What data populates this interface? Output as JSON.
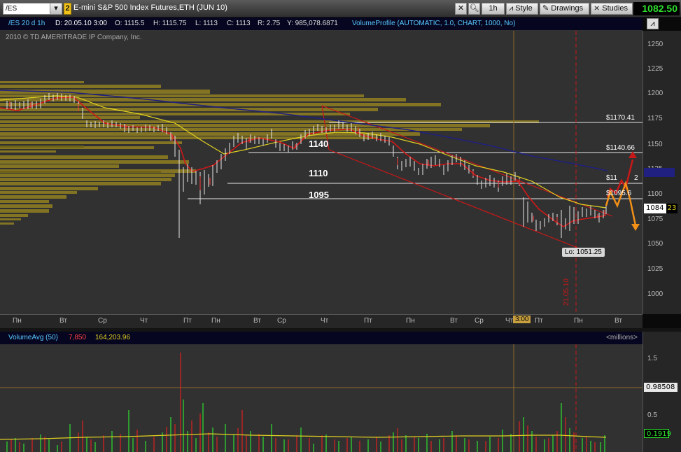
{
  "toolbar": {
    "symbol": "/ES",
    "link_number": "2",
    "instrument_title": "E-mini S&P 500 Index Futures,ETH (JUN 10)",
    "timeframe_label": "1h",
    "style_label": "Style",
    "drawings_label": "Drawings",
    "studies_label": "Studies",
    "last_price": "1082.50"
  },
  "header": {
    "chart_id": "/ES 20 d 1h",
    "date": "D: 20.05.10 3:00",
    "open": "O: 1115.5",
    "high": "H: 1115.75",
    "low": "L: 1113",
    "close": "C: 1113",
    "range": "R: 2.75",
    "volume": "Y: 985,078.6871",
    "study": "VolumeProfile (AUTOMATIC, 1.0, CHART, 1000, No)"
  },
  "copyright": "2010 © TD AMERITRADE IP Company, Inc.",
  "price_scale": [
    "1250",
    "1225",
    "1200",
    "1175",
    "1150",
    "1125",
    "1100",
    "1075",
    "1050",
    "1025",
    "1000"
  ],
  "price_box": {
    "price": "1084",
    "countdown": "23"
  },
  "levels": {
    "l1140": "1140",
    "l1110": "1110",
    "l1095": "1095"
  },
  "price_labels": {
    "p1170": "$1170.41",
    "p1140": "$1140.66",
    "p1110": "$11",
    "p1110b": "2",
    "p1095": "$1095.6",
    "low": "Lo: 1051.25"
  },
  "vertical_date": "21.05.10",
  "time_axis": {
    "labels": [
      "Пн",
      "Вт",
      "Ср",
      "Чт",
      "Пт",
      "Пн",
      "Вт",
      "Ср",
      "Чт",
      "Пт",
      "Пн",
      "Вт",
      "Ср",
      "Чт",
      "Пт",
      "Пн",
      "Вт"
    ],
    "marker": "3:00"
  },
  "volume_header": {
    "study": "VolumeAvg (50)",
    "value_red": "7,850",
    "value_yellow": "164,203.96",
    "units": "<millions>"
  },
  "volume_scale": [
    "1.5",
    "1",
    "0.5"
  ],
  "volume_boxes": {
    "avg": "0.98508",
    "current": "0.1919"
  },
  "colors": {
    "profile": "#8a7a22",
    "sma_short": "#e0d020",
    "ema_red": "#d01818",
    "sma_long": "#202080",
    "channel": "#c81818",
    "price_green": "#2ee02e"
  }
}
